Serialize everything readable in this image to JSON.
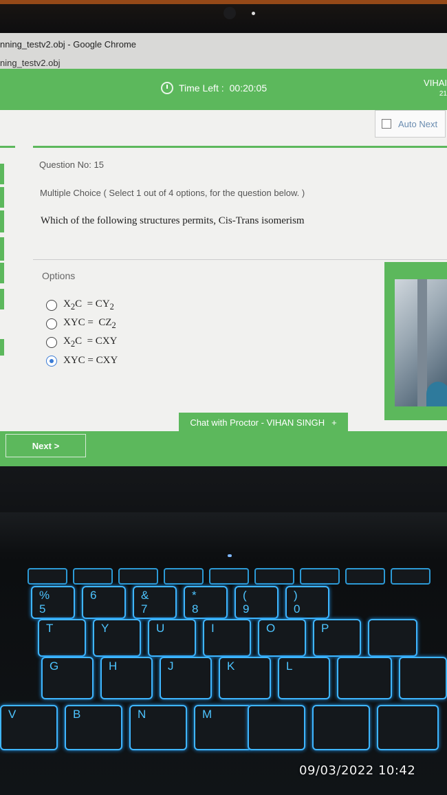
{
  "browser": {
    "window_title": "nning_testv2.obj - Google Chrome",
    "tab_title": "ning_testv2.obj"
  },
  "exam": {
    "time_left_label": "Time Left :",
    "time_left_value": "00:20:05",
    "user_name": "VIHAI",
    "user_number": "21",
    "auto_next_label": "Auto Next",
    "question_number_label": "Question No: 15",
    "question_type": "Multiple Choice ( Select 1 out of 4 options, for the question below. )",
    "question_text": "Which of the following structures permits, Cis-Trans isomerism",
    "options_label": "Options",
    "options": [
      {
        "html": "X<sub>2</sub>C &nbsp;= CY<sub>2</sub>",
        "selected": false
      },
      {
        "html": "XYC = &nbsp;CZ<sub>2</sub>",
        "selected": false
      },
      {
        "html": "X<sub>2</sub>C &nbsp;= CXY",
        "selected": false
      },
      {
        "html": "XYC = CXY",
        "selected": true
      }
    ],
    "chat_label": "Chat with Proctor - VIHAN SINGH",
    "chat_icon": "+",
    "next_label": "Next >"
  },
  "keyboard": {
    "number_row": [
      "%\n5",
      "6",
      "&\n7",
      "*\n8",
      "(\n9",
      ")\n0"
    ],
    "top_row": [
      "T",
      "Y",
      "U",
      "I",
      "O",
      "P"
    ],
    "home_row": [
      "G",
      "H",
      "J",
      "K",
      "L"
    ],
    "bottom_row": [
      "V",
      "B",
      "N",
      "M"
    ]
  },
  "timestamp": "09/03/2022 10:42",
  "colors": {
    "accent_green": "#5cb85c",
    "radio_selected": "#3a7bd5",
    "key_glow": "#3fb6ff"
  }
}
